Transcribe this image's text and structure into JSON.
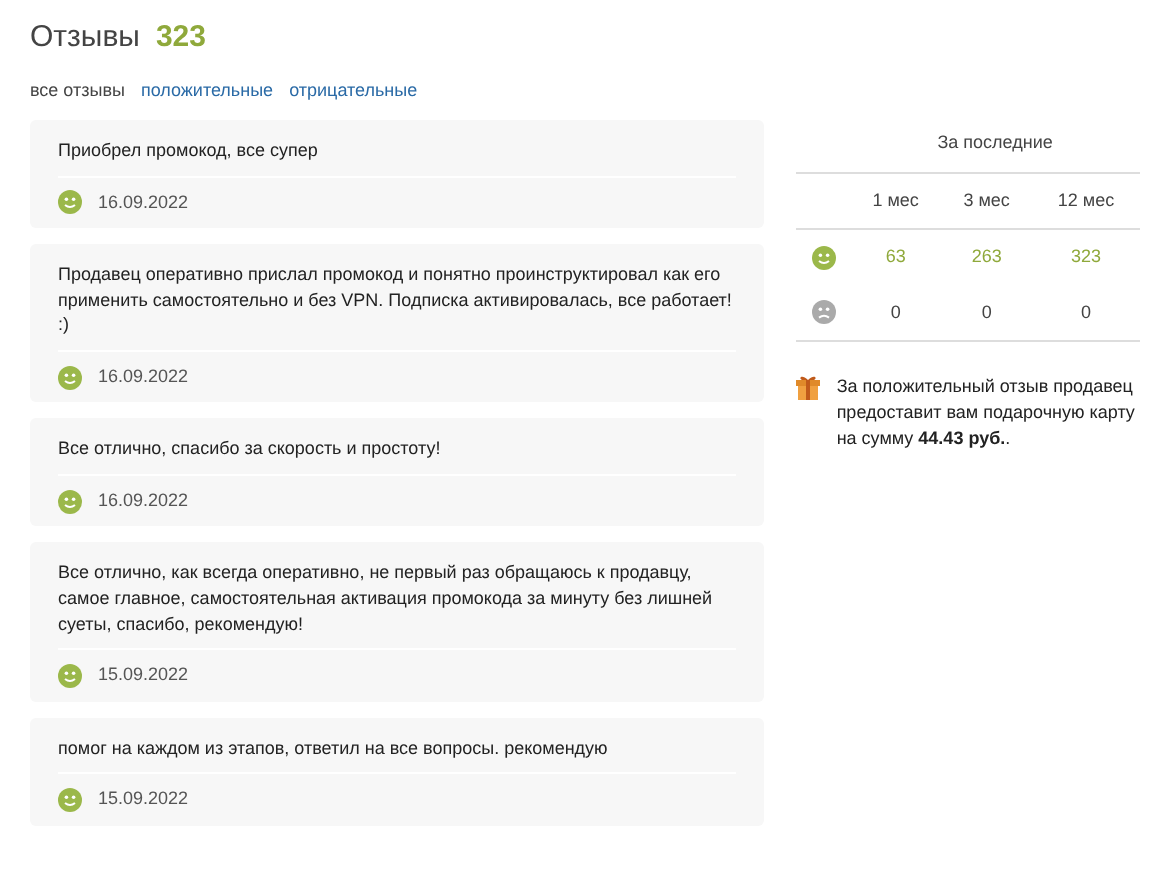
{
  "header": {
    "title": "Отзывы",
    "count": "323"
  },
  "filters": [
    {
      "label": "все отзывы",
      "selected": true
    },
    {
      "label": "положительные",
      "selected": false
    },
    {
      "label": "отрицательные",
      "selected": false
    }
  ],
  "reviews": [
    {
      "text": "Приобрел промокод, все супер",
      "kind": "positive",
      "date": "16.09.2022"
    },
    {
      "text": "Продавец оперативно прислал промокод и понятно проинструктировал как его применить самостоятельно и без VPN. Подписка активировалась, все работает! :)",
      "kind": "positive",
      "date": "16.09.2022"
    },
    {
      "text": "Все отлично, спасибо за скорость и простоту!",
      "kind": "positive",
      "date": "16.09.2022"
    },
    {
      "text": "Все отлично, как всегда оперативно, не первый раз обращаюсь к продавцу, самое главное, самостоятельная активация промокода за минуту без лишней суеты, спасибо, рекомендую!",
      "kind": "positive",
      "date": "15.09.2022"
    },
    {
      "text": "помог на каждом из этапов, ответил на все вопросы. рекомендую",
      "kind": "positive",
      "date": "15.09.2022"
    }
  ],
  "stats": {
    "caption": "За последние",
    "columns": [
      "1 мес",
      "3 мес",
      "12 мес"
    ],
    "rows": [
      {
        "kind": "positive",
        "values": [
          "63",
          "263",
          "323"
        ]
      },
      {
        "kind": "negative",
        "values": [
          "0",
          "0",
          "0"
        ]
      }
    ]
  },
  "gift_note": "За положительный отзыв продавец предоставит вам подарочную карту на сумму **44.43 руб.**."
}
